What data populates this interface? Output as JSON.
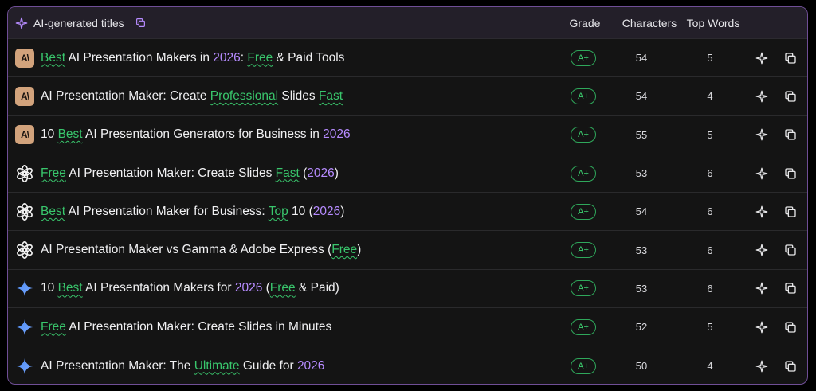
{
  "header": {
    "title": "AI-generated titles",
    "columns": {
      "grade": "Grade",
      "characters": "Characters",
      "top_words": "Top Words"
    }
  },
  "colors": {
    "accent_purple": "#B68BFF",
    "keyword_green": "#39C66C",
    "border_purple": "#6F4E96"
  },
  "rows": [
    {
      "source": "anthropic",
      "source_label": "A\\",
      "segments": [
        {
          "t": "Best",
          "c": "kw"
        },
        {
          "t": " AI Presentation Makers in ",
          "c": ""
        },
        {
          "t": "2026",
          "c": "yr"
        },
        {
          "t": ": ",
          "c": ""
        },
        {
          "t": "Free",
          "c": "kw"
        },
        {
          "t": " & Paid Tools",
          "c": ""
        }
      ],
      "grade": "A+",
      "characters": "54",
      "top_words": "5"
    },
    {
      "source": "anthropic",
      "source_label": "A\\",
      "segments": [
        {
          "t": "AI Presentation Maker: Create ",
          "c": ""
        },
        {
          "t": "Professional",
          "c": "kw"
        },
        {
          "t": " Slides ",
          "c": ""
        },
        {
          "t": "Fast",
          "c": "kw"
        }
      ],
      "grade": "A+",
      "characters": "54",
      "top_words": "4"
    },
    {
      "source": "anthropic",
      "source_label": "A\\",
      "segments": [
        {
          "t": "10 ",
          "c": ""
        },
        {
          "t": "Best",
          "c": "kw"
        },
        {
          "t": " AI Presentation Generators for Business in ",
          "c": ""
        },
        {
          "t": "2026",
          "c": "yr"
        }
      ],
      "grade": "A+",
      "characters": "55",
      "top_words": "5"
    },
    {
      "source": "openai",
      "segments": [
        {
          "t": "Free",
          "c": "kw"
        },
        {
          "t": " AI Presentation Maker: Create Slides ",
          "c": ""
        },
        {
          "t": "Fast",
          "c": "kw"
        },
        {
          "t": " (",
          "c": ""
        },
        {
          "t": "2026",
          "c": "yr"
        },
        {
          "t": ")",
          "c": ""
        }
      ],
      "grade": "A+",
      "characters": "53",
      "top_words": "6"
    },
    {
      "source": "openai",
      "segments": [
        {
          "t": "Best",
          "c": "kw"
        },
        {
          "t": " AI Presentation Maker for Business: ",
          "c": ""
        },
        {
          "t": "Top",
          "c": "kw"
        },
        {
          "t": " 10 (",
          "c": ""
        },
        {
          "t": "2026",
          "c": "yr"
        },
        {
          "t": ")",
          "c": ""
        }
      ],
      "grade": "A+",
      "characters": "54",
      "top_words": "6"
    },
    {
      "source": "openai",
      "segments": [
        {
          "t": "AI Presentation Maker vs Gamma & Adobe Express (",
          "c": ""
        },
        {
          "t": "Free",
          "c": "kw"
        },
        {
          "t": ")",
          "c": ""
        }
      ],
      "grade": "A+",
      "characters": "53",
      "top_words": "6"
    },
    {
      "source": "gemini",
      "segments": [
        {
          "t": "10 ",
          "c": ""
        },
        {
          "t": "Best",
          "c": "kw"
        },
        {
          "t": " AI Presentation Makers for ",
          "c": ""
        },
        {
          "t": "2026",
          "c": "yr"
        },
        {
          "t": " (",
          "c": ""
        },
        {
          "t": "Free",
          "c": "kw"
        },
        {
          "t": " & Paid)",
          "c": ""
        }
      ],
      "grade": "A+",
      "characters": "53",
      "top_words": "6"
    },
    {
      "source": "gemini",
      "segments": [
        {
          "t": "Free",
          "c": "kw"
        },
        {
          "t": " AI Presentation Maker: Create Slides in Minutes",
          "c": ""
        }
      ],
      "grade": "A+",
      "characters": "52",
      "top_words": "5"
    },
    {
      "source": "gemini",
      "segments": [
        {
          "t": "AI Presentation Maker: The ",
          "c": ""
        },
        {
          "t": "Ultimate",
          "c": "kw"
        },
        {
          "t": " Guide for ",
          "c": ""
        },
        {
          "t": "2026",
          "c": "yr"
        }
      ],
      "grade": "A+",
      "characters": "50",
      "top_words": "4"
    }
  ]
}
